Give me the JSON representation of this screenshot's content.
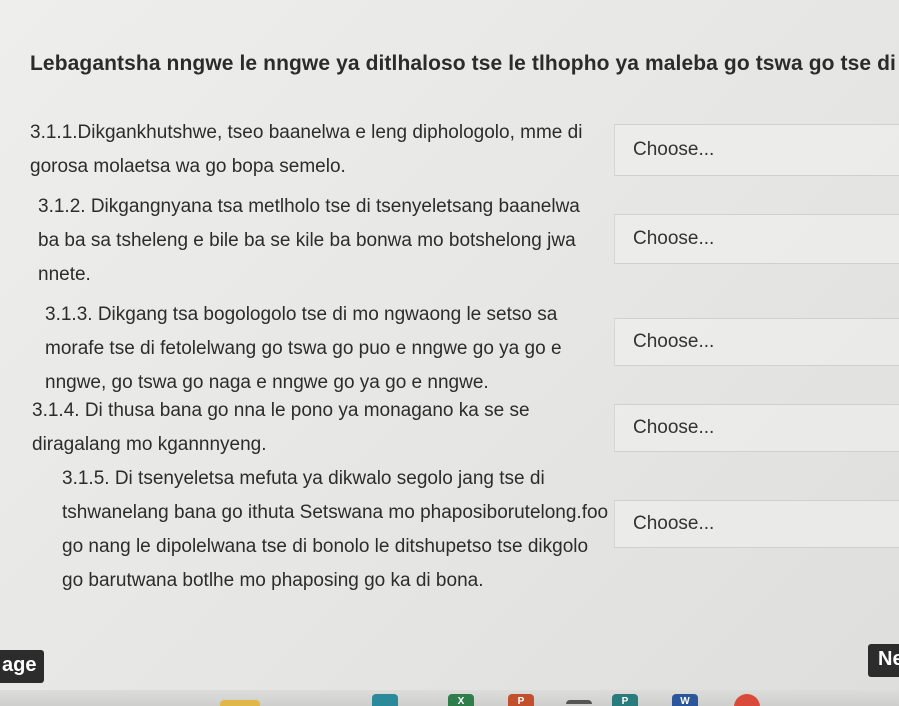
{
  "instruction": "Lebagantsha nngwe le nngwe ya ditlhaloso tse le tlhopho ya maleba go tswa go tse di neetsweng.",
  "questions": [
    {
      "lines": [
        "3.1.1.Dikgankhutshwe, tseo baanelwa e leng diphologolo, mme di",
        "gorosa molaetsa wa go bopa semelo."
      ],
      "select_label": "Choose..."
    },
    {
      "lines": [
        "3.1.2. Dikgangnyana tsa metlholo tse di tsenyeletsang baanelwa",
        "ba ba sa tsheleng e bile ba se kile ba bonwa mo botshelong jwa",
        "nnete."
      ],
      "select_label": "Choose..."
    },
    {
      "lines": [
        "3.1.3. Dikgang tsa bogologolo tse di mo ngwaong le setso sa",
        "morafe tse di fetolelwang go tswa go puo e nngwe go ya go e",
        "nngwe, go tswa go naga e nngwe go ya go e nngwe."
      ],
      "select_label": "Choose..."
    },
    {
      "lines": [
        "3.1.4. Di thusa bana go nna le pono ya monagano ka se se",
        "diragalang mo kgannnyeng."
      ],
      "select_label": "Choose..."
    },
    {
      "lines": [
        "3.1.5. Di tsenyeletsa mefuta ya dikwalo segolo jang tse di",
        "tshwanelang bana go ithuta Setswana mo phaposiborutelong.foo",
        "go nang le dipolelwana tse di bonolo le ditshupetso tse dikgolo",
        "go barutwana botlhe mo phaposing go ka di bona."
      ],
      "select_label": "Choose..."
    }
  ],
  "nav": {
    "prev_label": "age",
    "next_label": "Ne"
  },
  "taskbar": {
    "icons": [
      {
        "name": "folder-icon",
        "color": "#e0b84a",
        "glyph": ""
      },
      {
        "name": "browser-icon",
        "color": "#2a8a9a",
        "glyph": ""
      },
      {
        "name": "excel-icon",
        "color": "#2e7d4a",
        "glyph": "X"
      },
      {
        "name": "powerpoint-icon",
        "color": "#c1502e",
        "glyph": "P"
      },
      {
        "name": "app-icon",
        "color": "#555555",
        "glyph": ""
      },
      {
        "name": "publisher-icon",
        "color": "#2a7b7b",
        "glyph": "P"
      },
      {
        "name": "word-icon",
        "color": "#2b579a",
        "glyph": "W"
      },
      {
        "name": "chrome-icon",
        "color": "#d94a3a",
        "glyph": ""
      }
    ]
  },
  "colors": {
    "text": "#2c2c2c",
    "nav_bg": "#2c2c2c",
    "select_border": "#d0d0ce"
  }
}
